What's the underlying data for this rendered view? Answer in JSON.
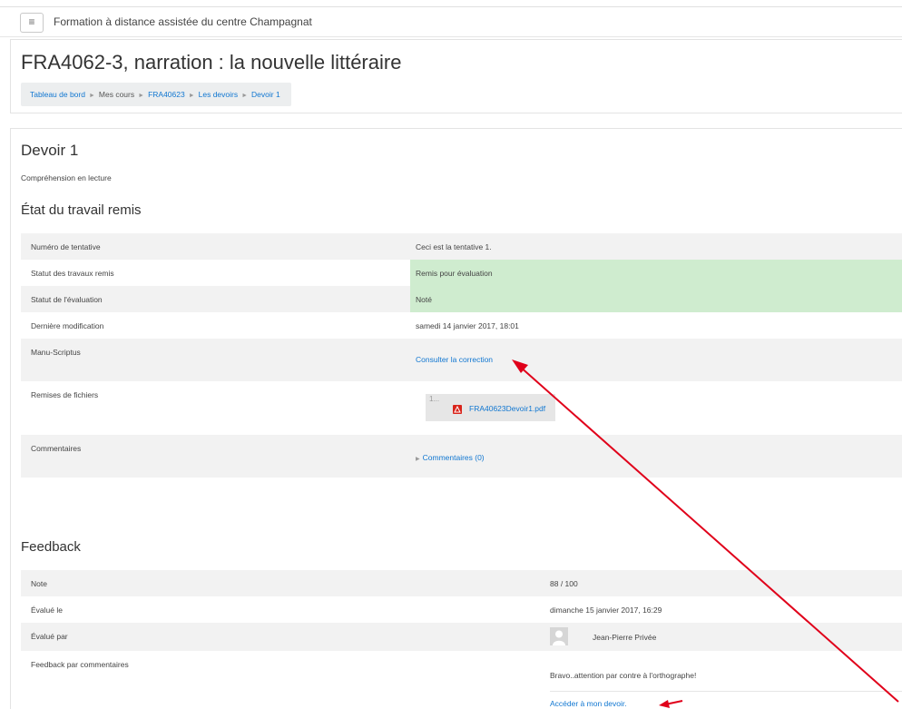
{
  "topbar": {
    "menu_icon": "hamburger-icon",
    "menu_glyph": "≡",
    "site_name": "Formation à distance assistée du centre Champagnat"
  },
  "header": {
    "title": "FRA4062-3, narration : la nouvelle littéraire",
    "breadcrumb": [
      "Tableau de bord",
      "Mes cours",
      "FRA40623",
      "Les devoirs",
      "Devoir 1"
    ],
    "breadcrumb_sep": "►"
  },
  "assignment": {
    "title": "Devoir 1",
    "description": "Compréhension en lecture",
    "status_heading": "État du travail remis",
    "status_rows": [
      {
        "label": "Numéro de tentative",
        "value": "Ceci est la tentative 1."
      },
      {
        "label": "Statut des travaux remis",
        "value": "Remis pour évaluation"
      },
      {
        "label": "Statut de l'évaluation",
        "value": "Noté"
      },
      {
        "label": "Dernière modification",
        "value": "samedi 14 janvier 2017, 18:01"
      },
      {
        "label": "Manu-Scriptus",
        "value": "Consulter la correction"
      },
      {
        "label": "Remises de fichiers",
        "value": "FRA40623Devoir1.pdf",
        "file_dots": "1..."
      },
      {
        "label": "Commentaires",
        "value": "Commentaires (0)"
      }
    ],
    "status_ok_color": "#cfeccf",
    "feedback_heading": "Feedback",
    "feedback_rows": [
      {
        "label": "Note",
        "value": "88 / 100"
      },
      {
        "label": "Évalué le",
        "value": "dimanche 15 janvier 2017, 16:29"
      },
      {
        "label": "Évalué par",
        "value": "Jean-Pierre Privée"
      },
      {
        "label": "Feedback par commentaires",
        "value": "Bravo..attention par contre à l'orthographe!",
        "link": "Accéder à mon devoir."
      }
    ]
  },
  "colors": {
    "link": "#1177d1",
    "annotation_arrow": "#e0001a",
    "pdf_icon": "#d9241b"
  }
}
